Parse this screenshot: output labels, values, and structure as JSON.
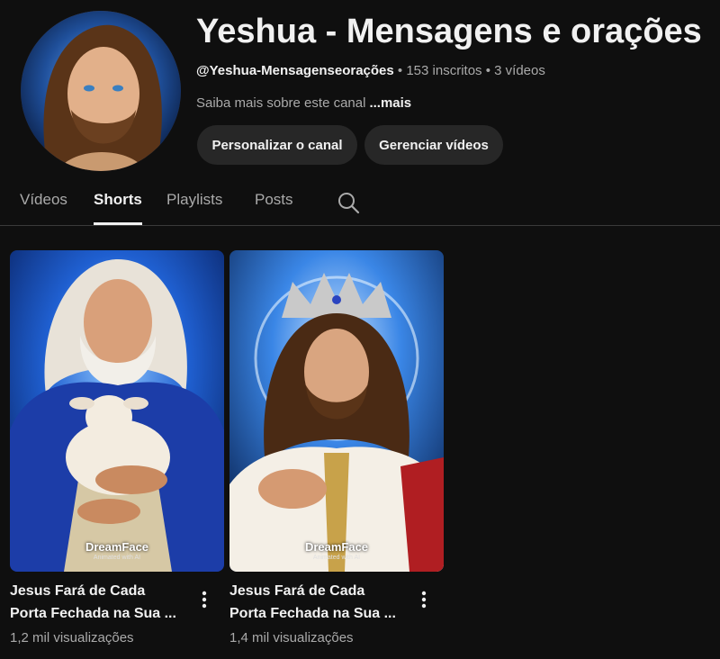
{
  "channel": {
    "name": "Yeshua - Mensagens e orações",
    "handle": "@Yeshua-Mensagenseorações",
    "subscribers": "153 inscritos",
    "videos_count": "3 vídeos",
    "separator": " • ",
    "about_text": "Saiba mais sobre este canal",
    "about_more": "...mais",
    "customize_label": "Personalizar o canal",
    "manage_label": "Gerenciar vídeos"
  },
  "tabs": [
    {
      "label": "Vídeos",
      "active": false
    },
    {
      "label": "Shorts",
      "active": true
    },
    {
      "label": "Playlists",
      "active": false
    },
    {
      "label": "Posts",
      "active": false
    }
  ],
  "shorts": [
    {
      "title_line1": "Jesus Fará de Cada",
      "title_line2": "Porta Fechada na Sua ...",
      "views": "1,2 mil visualizações",
      "watermark": "DreamFace",
      "watermark_sub": "Animated with AI"
    },
    {
      "title_line1": "Jesus Fará de Cada",
      "title_line2": "Porta Fechada na Sua ...",
      "views": "1,4 mil visualizações",
      "watermark": "DreamFace",
      "watermark_sub": "Animated with AI"
    }
  ],
  "icons": {
    "search": "search-icon",
    "camera": "camera-icon",
    "more": "more-vert-icon"
  },
  "colors": {
    "background": "#0f0f0f",
    "button": "#272727",
    "text_primary": "#f1f1f1",
    "text_secondary": "#aaaaaa"
  }
}
